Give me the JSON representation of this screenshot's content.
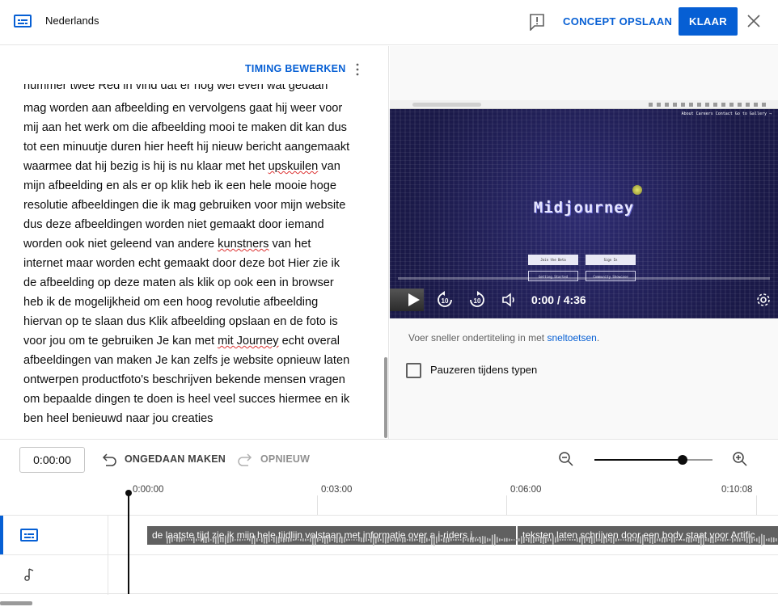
{
  "header": {
    "language": "Nederlands",
    "save_draft_label": "CONCEPT OPSLAAN",
    "done_label": "KLAAR"
  },
  "editor": {
    "timing_label": "TIMING BEWERKEN",
    "transcript_clipped_line": "nummer twee Red in vind dat er nog wel even wat gedaan",
    "transcript_lines": [
      "mag worden aan afbeelding en vervolgens gaat hij weer voor",
      "mij aan het werk om die afbeelding mooi te maken dit kan dus",
      "tot een minuutje duren hier heeft hij nieuw bericht aangemaakt",
      "waarmee dat hij bezig is hij is nu klaar met het upskuilen van",
      "mijn afbeelding en als er op klik heb ik een hele mooie hoge",
      "resolutie afbeeldingen die ik mag gebruiken voor mijn website",
      "dus deze afbeeldingen worden niet gemaakt door iemand",
      "worden ook niet geleend van andere kunstners van het",
      "internet maar worden echt gemaakt door deze bot Hier zie ik",
      "de afbeelding op deze maten als klik op ook een in browser",
      "heb ik de mogelijkheid om een hoog revolutie afbeelding",
      "hiervan op te slaan dus Klik afbeelding opslaan en de foto is",
      "voor jou om te gebruiken Je kan met mit Journey echt overal",
      "afbeeldingen van maken Je kan zelfs je website opnieuw laten",
      "ontwerpen productfoto's beschrijven bekende mensen vragen",
      "om bepaalde dingen te doen is heel veel succes hiermee en ik",
      "ben heel benieuwd naar jou creaties"
    ],
    "misspelled": [
      "upskuilen",
      "kunstners",
      "mit Journey"
    ]
  },
  "video": {
    "site_nav": "About  Careers  Contact   Go to Gallery →",
    "logo_text": "Midjourney",
    "buttons": [
      "Join the Beta",
      "Sign In",
      "Getting Started",
      "Community Showcase"
    ],
    "time_display": "0:00 / 4:36",
    "progress": 0
  },
  "sidepanel": {
    "hint_prefix": "Voer sneller ondertiteling in met ",
    "hint_link": "sneltoetsen",
    "hint_suffix": ".",
    "pause_label": "Pauzeren tijdens typen",
    "pause_checked": false
  },
  "toolbar": {
    "timecode": "0:00:00",
    "undo_label": "ONGEDAAN MAKEN",
    "redo_label": "OPNIEUW",
    "zoom_level": 0.75
  },
  "timeline": {
    "ruler": [
      "0:00:00",
      "0:03:00",
      "0:06:00",
      "0:10:08"
    ],
    "cues": [
      "de laatste tijd zie ik mijn hele tijdlijn volstaan  met informatie over a i-riders j...",
      "teksten laten schrijven door een body staat  voor Artific"
    ]
  },
  "colors": {
    "accent": "#065fd4",
    "cue": "#606060",
    "video_bg": "#1f1e56"
  }
}
